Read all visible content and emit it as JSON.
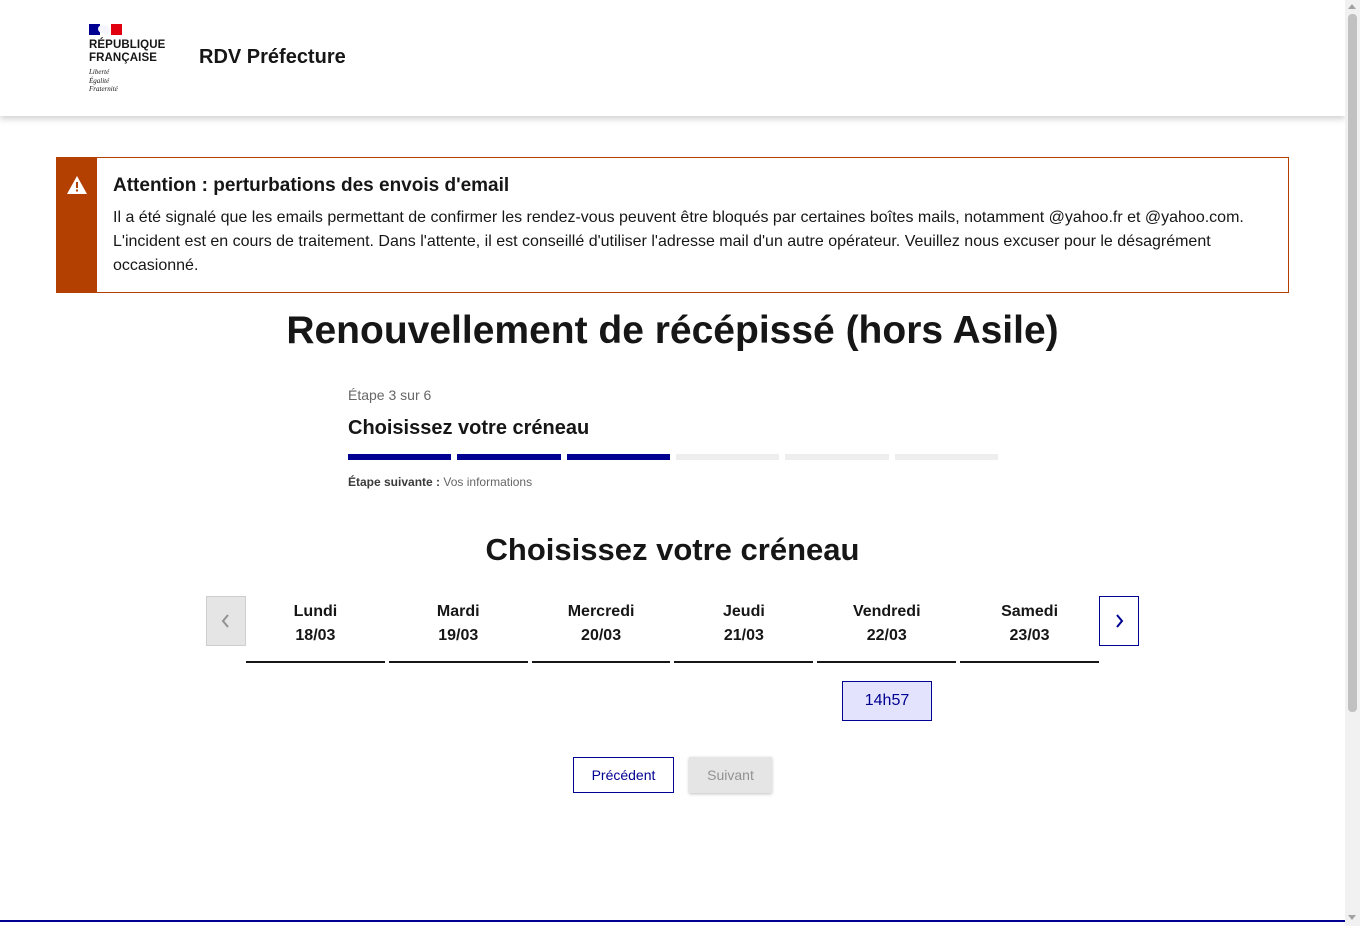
{
  "header": {
    "logo_line1": "RÉPUBLIQUE",
    "logo_line2": "FRANÇAISE",
    "motto_1": "Liberté",
    "motto_2": "Égalité",
    "motto_3": "Fraternité",
    "service_title": "RDV Préfecture"
  },
  "alert": {
    "icon": "warning-icon",
    "title": "Attention : perturbations des envois d'email",
    "text": "Il a été signalé que les emails permettant de confirmer les rendez-vous peuvent être bloqués par certaines boîtes mails, notamment @yahoo.fr et @yahoo.com. L'incident est en cours de traitement. Dans l'attente, il est conseillé d'utiliser l'adresse mail d'un autre opérateur. Veuillez nous excuser pour le désagrément occasionné.",
    "color": "#b34000"
  },
  "page_title": "Renouvellement de récépissé (hors Asile)",
  "stepper": {
    "state": "Étape 3 sur 6",
    "title": "Choisissez votre créneau",
    "current_step": 3,
    "total_steps": 6,
    "next_label": "Étape suivante :",
    "next_value": "Vos informations"
  },
  "section_title": "Choisissez votre créneau",
  "calendar": {
    "prev_icon": "chevron-left-icon",
    "next_icon": "chevron-right-icon",
    "days": [
      {
        "name": "Lundi",
        "date": "18/03"
      },
      {
        "name": "Mardi",
        "date": "19/03"
      },
      {
        "name": "Mercredi",
        "date": "20/03"
      },
      {
        "name": "Jeudi",
        "date": "21/03"
      },
      {
        "name": "Vendredi",
        "date": "22/03"
      },
      {
        "name": "Samedi",
        "date": "23/03"
      }
    ],
    "slot": "14h57"
  },
  "buttons": {
    "previous": "Précédent",
    "next": "Suivant"
  },
  "colors": {
    "primary": "#000091",
    "warning": "#b34000",
    "slot_bg": "#e3e3fd"
  }
}
